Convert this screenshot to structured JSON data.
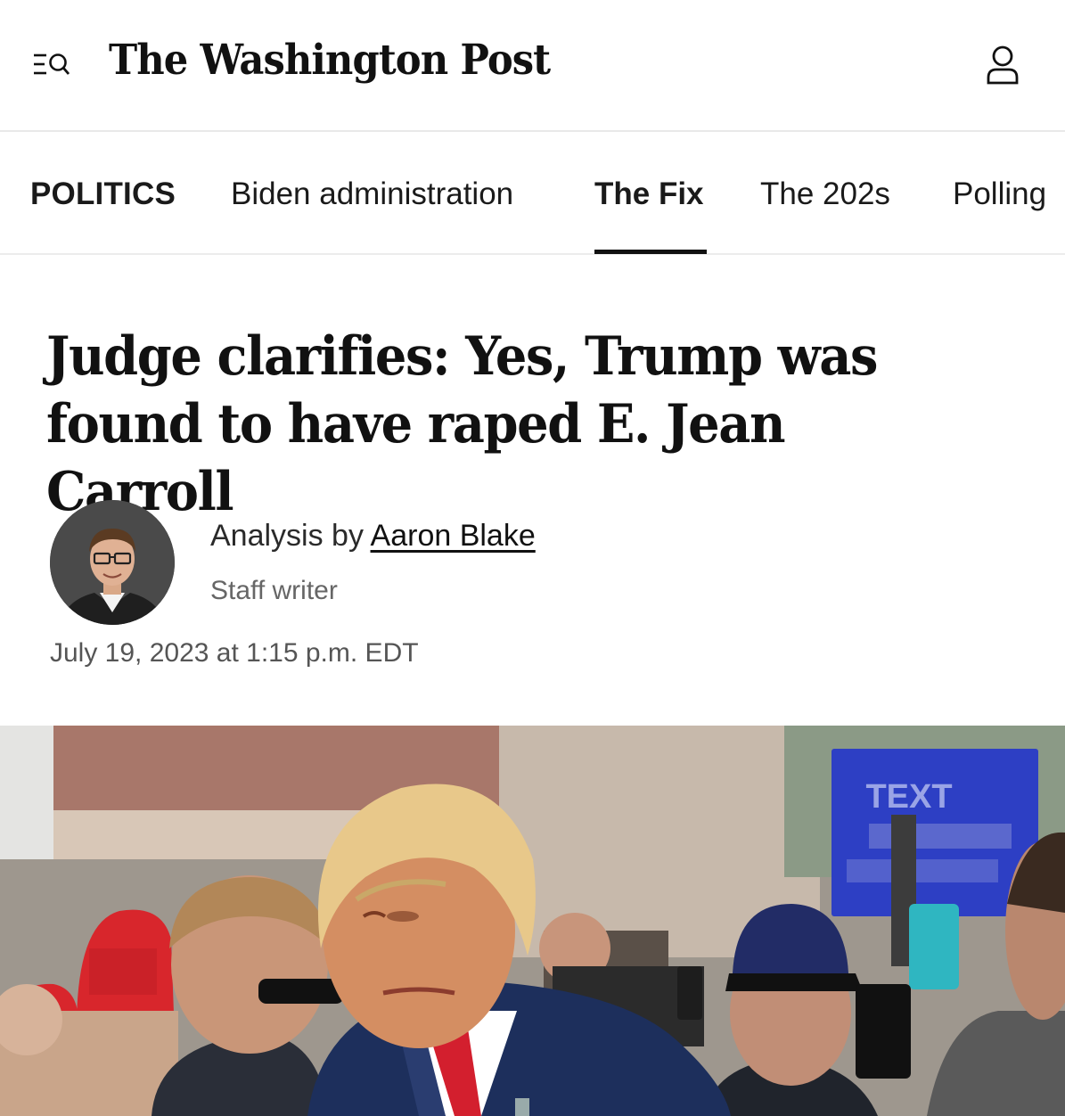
{
  "header": {
    "masthead": "The Washington Post",
    "menu_icon": "menu-search-icon",
    "account_icon": "account-icon"
  },
  "nav": {
    "section": "POLITICS",
    "items": [
      {
        "label": "Biden administration",
        "active": false
      },
      {
        "label": "The Fix",
        "active": true
      },
      {
        "label": "The 202s",
        "active": false
      },
      {
        "label": "Polling",
        "active": false
      }
    ]
  },
  "article": {
    "headline": "Judge clarifies: Yes, Trump was found to have raped E. Jean Carroll",
    "byline_prefix": "Analysis by ",
    "author": "Aaron Blake",
    "author_role": "Staff writer",
    "date": "July 19, 2023 at 1:15 p.m. EDT"
  },
  "photo": {
    "sign_text": "TEXT"
  },
  "colors": {
    "text": "#111111",
    "muted": "#666666",
    "divider": "#e9e9e9",
    "sign_blue": "#2d3fc4",
    "cap_red": "#d8262c"
  }
}
